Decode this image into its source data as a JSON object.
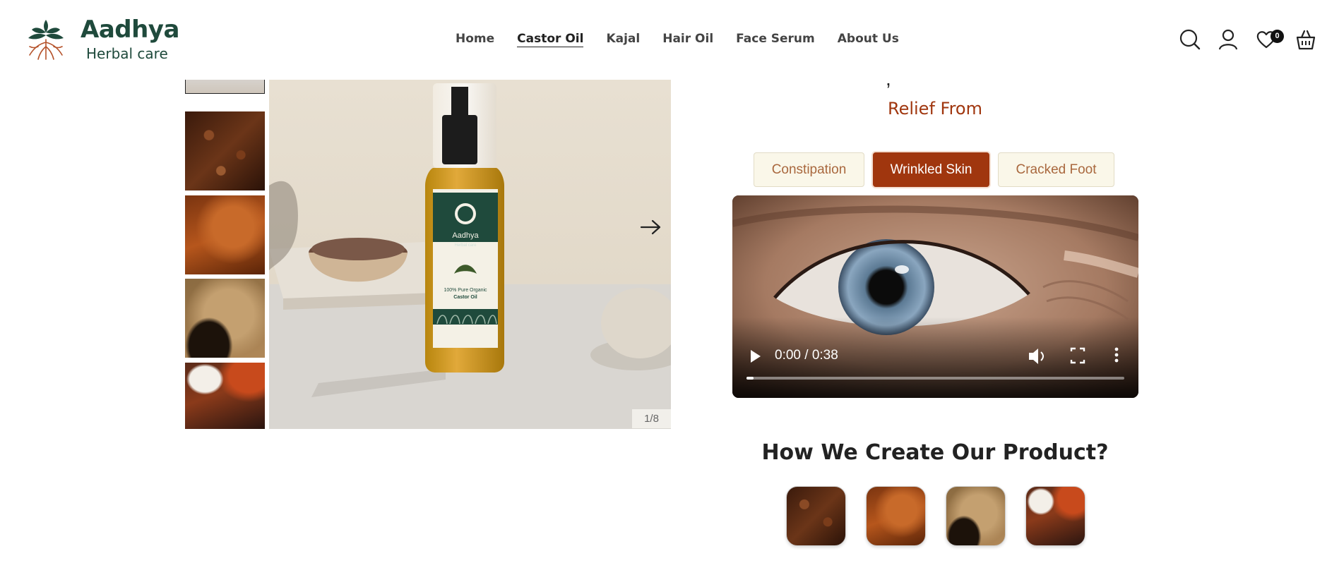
{
  "header": {
    "brand_name": "Aadhya",
    "brand_sub": "Herbal care",
    "nav": [
      {
        "label": "Home"
      },
      {
        "label": "Castor Oil",
        "active": true
      },
      {
        "label": "Kajal"
      },
      {
        "label": "Hair Oil"
      },
      {
        "label": "Face Serum"
      },
      {
        "label": "About Us"
      }
    ],
    "icons": [
      "search-icon",
      "account-icon",
      "wishlist-icon",
      "cart-icon"
    ],
    "wishlist_count": "0"
  },
  "gallery": {
    "counter": "1/8",
    "bottle_label": {
      "brand": "Aadhya",
      "sub": "Herbal care",
      "line1": "100% Pure Organic",
      "line2": "Castor Oil"
    }
  },
  "relief": {
    "heading": "Relief From",
    "tabs": [
      "Constipation",
      "Wrinkled Skin",
      "Cracked Foot"
    ],
    "selected_tab": "Wrinkled Skin"
  },
  "video": {
    "time": "0:00 / 0:38",
    "progress": 0.0
  },
  "process": {
    "heading": "How We Create Our Product?"
  },
  "colors": {
    "brand_green": "#1f4a3c",
    "accent": "#a0360e",
    "tab_bg": "#faf7e9"
  }
}
